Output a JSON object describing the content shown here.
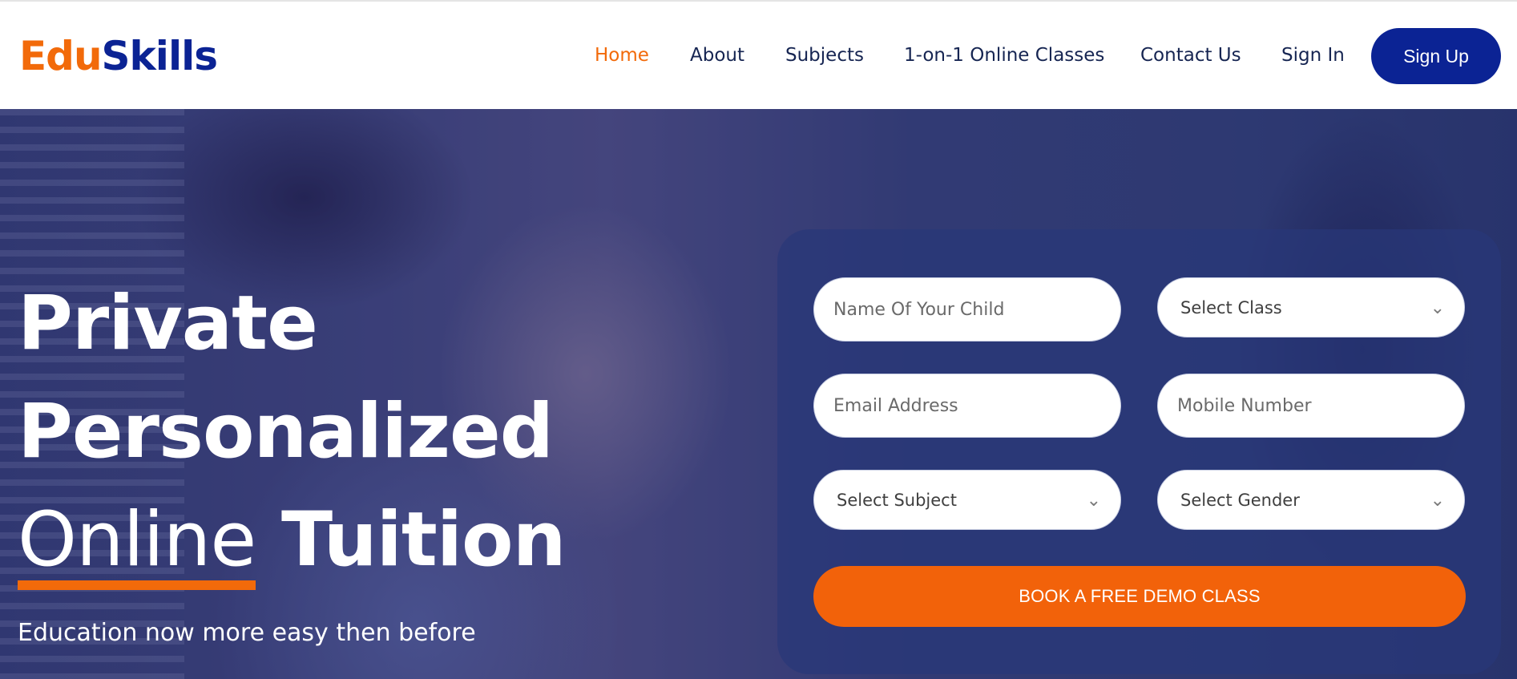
{
  "brand": {
    "part1": "Edu",
    "part2": "Skills"
  },
  "nav": {
    "items": [
      {
        "label": "Home",
        "active": true
      },
      {
        "label": "About"
      },
      {
        "label": "Subjects"
      },
      {
        "label": "1-on-1 Online Classes"
      },
      {
        "label": "Contact Us"
      },
      {
        "label": "Sign In"
      }
    ],
    "signup_label": "Sign Up"
  },
  "hero": {
    "line1": "Private",
    "line2": "Personalized",
    "line3_underlined": "Online",
    "line3_rest": "Tuition",
    "subline": "Education now more easy then before"
  },
  "form": {
    "child_name_placeholder": "Name Of Your Child",
    "class_select": "Select Class",
    "email_placeholder": "Email Address",
    "mobile_placeholder": "Mobile Number",
    "subject_select": "Select Subject",
    "gender_select": "Select Gender",
    "submit_label": "BOOK A FREE DEMO CLASS"
  },
  "icons": {
    "dropdown": "chevron-down-icon"
  },
  "colors": {
    "brand_orange": "#f26a0a",
    "brand_navy": "#0b2394",
    "nav_text": "#162552"
  }
}
